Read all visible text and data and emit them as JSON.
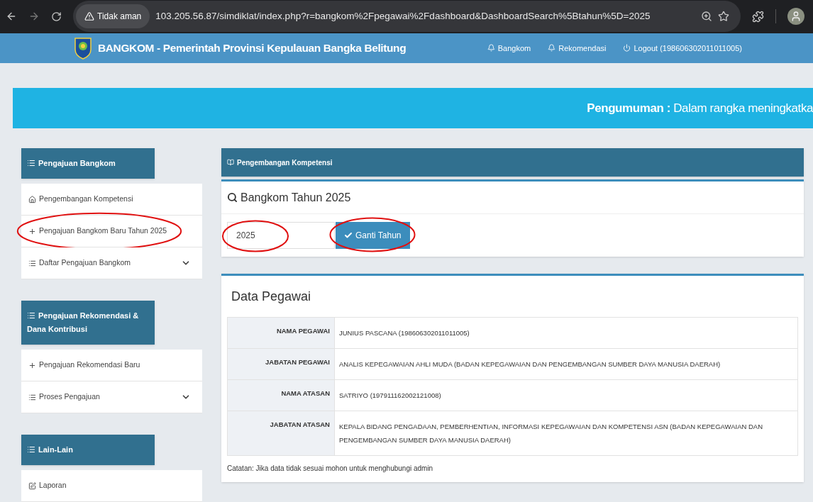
{
  "browser": {
    "security_label": "Tidak aman",
    "url": "103.205.56.87/simdiklat/index.php?r=bangkom%2Fpegawai%2Fdashboard&DashboardSearch%5Btahun%5D=2025"
  },
  "header": {
    "title": "BANGKOM - Pemerintah Provinsi Kepulauan Bangka Belitung",
    "nav": [
      {
        "kind": "notification",
        "label": "Bangkom"
      },
      {
        "kind": "notification",
        "label": "Rekomendasi"
      },
      {
        "kind": "logout",
        "label": "Logout (198606302011011005)"
      }
    ]
  },
  "announcement": {
    "label": "Pengumuman :",
    "text": "Dalam rangka meningkatka"
  },
  "sidebar": {
    "sections": [
      {
        "title": "Pengajuan Bangkom",
        "items": [
          {
            "kind": "home",
            "label": "Pengembangan Kompetensi",
            "highlighted": false,
            "expandable": false
          },
          {
            "kind": "add",
            "label": "Pengajuan Bangkom Baru Tahun 2025",
            "highlighted": true,
            "expandable": false
          },
          {
            "kind": "list",
            "label": "Daftar Pengajuan Bangkom",
            "highlighted": false,
            "expandable": true
          }
        ]
      },
      {
        "title": "Pengajuan Rekomendasi & Dana Kontribusi",
        "items": [
          {
            "kind": "add",
            "label": "Pengajuan Rekomendasi Baru",
            "highlighted": false,
            "expandable": false
          },
          {
            "kind": "list",
            "label": "Proses Pengajuan",
            "highlighted": false,
            "expandable": true
          }
        ]
      },
      {
        "title": "Lain-Lain",
        "items": [
          {
            "kind": "report",
            "label": "Laporan",
            "highlighted": false,
            "expandable": false
          }
        ]
      }
    ]
  },
  "main": {
    "panel_title": "Pengembangan Kompetensi",
    "search": {
      "title": "Bangkom Tahun 2025",
      "year_value": "2025",
      "year_highlighted": true,
      "button": "Ganti Tahun",
      "button_highlighted": true
    },
    "employee": {
      "title": "Data Pegawai",
      "rows": [
        {
          "label": "NAMA PEGAWAI",
          "value": "JUNIUS PASCANA (198606302011011005)"
        },
        {
          "label": "JABATAN PEGAWAI",
          "value": "ANALIS KEPEGAWAIAN AHLI MUDA (BADAN KEPEGAWAIAN DAN PENGEMBANGAN SUMBER DAYA MANUSIA DAERAH)"
        },
        {
          "label": "NAMA ATASAN",
          "value": "SATRIYO (197911162002121008)"
        },
        {
          "label": "JABATAN ATASAN",
          "value": "KEPALA BIDANG PENGADAAN, PEMBERHENTIAN, INFORMASI KEPEGAWAIAN DAN KOMPETENSI ASN (BADAN KEPEGAWAIAN DAN PENGEMBANGAN SUMBER DAYA MANUSIA DAERAH)"
        }
      ],
      "note": "Catatan: Jika data tidak sesuai mohon untuk menghubungi admin"
    }
  }
}
